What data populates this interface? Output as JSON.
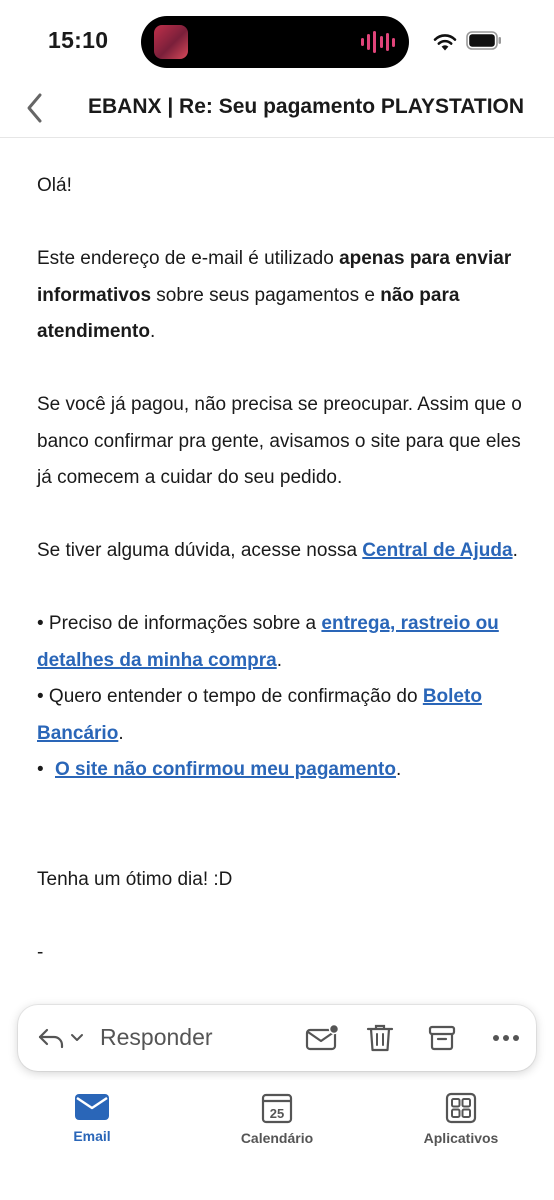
{
  "status_bar": {
    "time": "15:10"
  },
  "header": {
    "subject": "EBANX | Re: Seu pagamento PLAYSTATION"
  },
  "body": {
    "greeting": "Olá!",
    "p1_a": "Este endereço de e-mail é utilizado ",
    "p1_b": "apenas para enviar informativos",
    "p1_c": " sobre seus pagamentos e ",
    "p1_d": "não para atendimento",
    "p1_e": ".",
    "p2": "Se você já pagou, não precisa se preocupar. Assim que o banco confirmar pra gente, avisamos o site para que eles já comecem a cuidar do seu pedido.",
    "p3_a": "Se tiver alguma dúvida, acesse nossa ",
    "p3_link": "Central de Ajuda",
    "p3_b": ".",
    "bullet1_a": "• Preciso de informações sobre a ",
    "bullet1_link": "entrega, rastreio ou detalhes da minha compra",
    "bullet1_b": ".",
    "bullet2_a": "•  Quero entender o tempo de confirmação do ",
    "bullet2_link": "Boleto Bancário",
    "bullet2_b": ".",
    "bullet3_a": "•",
    "bullet3_link": "O site não confirmou meu pagamento",
    "bullet3_b": ".",
    "closing": "Tenha um ótimo dia! :D",
    "signature_dash": "-"
  },
  "reply_bar": {
    "reply_label": "Responder"
  },
  "tabs": [
    {
      "label": "Email",
      "active": true,
      "icon": "mail-icon"
    },
    {
      "label": "Calendário",
      "active": false,
      "icon": "calendar-icon",
      "day": "25"
    },
    {
      "label": "Aplicativos",
      "active": false,
      "icon": "apps-icon"
    }
  ],
  "colors": {
    "accent": "#2a66b8",
    "link": "#2a66b8",
    "text": "#1a1a1a",
    "muted": "#555555"
  }
}
